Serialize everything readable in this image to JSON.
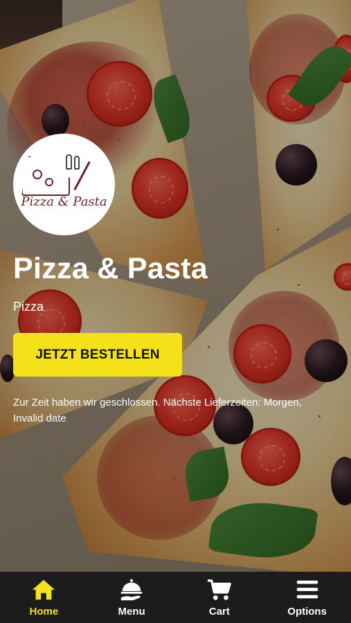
{
  "restaurant": {
    "logo_text": "Pizza & Pasta",
    "name": "Pizza & Pasta",
    "category": "Pizza"
  },
  "order_button": {
    "label": "JETZT BESTELLEN"
  },
  "status": {
    "closed_message": "Zur Zeit haben wir geschlossen. Nächste Lieferzeiten: Morgen, Invalid date"
  },
  "nav": {
    "items": [
      {
        "label": "Home",
        "icon": "home-icon",
        "active": true
      },
      {
        "label": "Menu",
        "icon": "cloche-hand-icon",
        "active": false
      },
      {
        "label": "Cart",
        "icon": "cart-icon",
        "active": false
      },
      {
        "label": "Options",
        "icon": "hamburger-icon",
        "active": false
      }
    ]
  },
  "colors": {
    "accent": "#f5e11a",
    "nav_background": "#1c1c1c",
    "logo_text": "#6e1f2a"
  }
}
